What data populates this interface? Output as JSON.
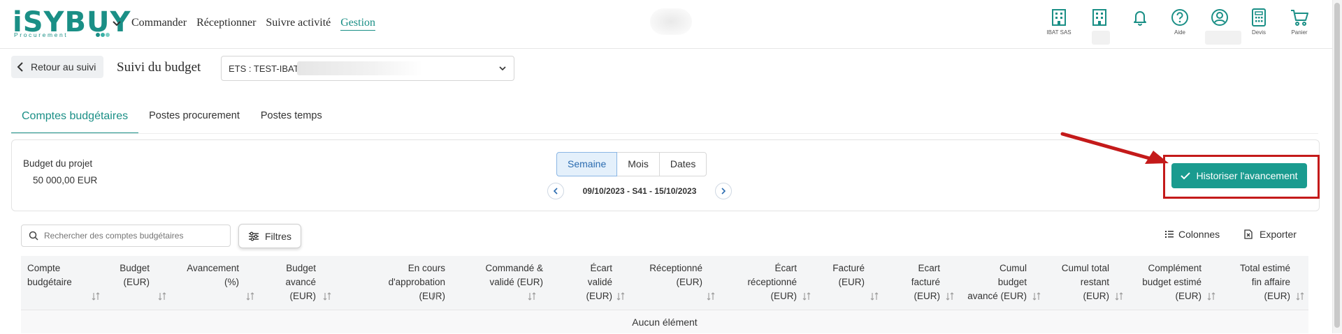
{
  "header": {
    "logo_text": "iSYBUY",
    "logo_subtext": "Procurement",
    "nav": [
      "Commander",
      "Réceptionner",
      "Suivre activité",
      "Gestion"
    ],
    "active_nav": "Gestion",
    "tools": [
      {
        "icon": "building-icon",
        "label": "IBAT SAS"
      },
      {
        "icon": "building-icon",
        "label": ""
      },
      {
        "icon": "bell-icon",
        "label": ""
      },
      {
        "icon": "help-icon",
        "label": "Aide"
      },
      {
        "icon": "user-icon",
        "label": ""
      },
      {
        "icon": "calculator-icon",
        "label": "Devis"
      },
      {
        "icon": "cart-icon",
        "label": "Panier"
      }
    ]
  },
  "subheader": {
    "back_label": "Retour au suivi",
    "title": "Suivi du budget",
    "ets_value": "ETS : TEST-IBAT"
  },
  "tabs": [
    "Comptes budgétaires",
    "Postes procurement",
    "Postes temps"
  ],
  "active_tab": "Comptes budgétaires",
  "budget": {
    "label": "Budget du projet",
    "value": "50 000,00 EUR",
    "periods": [
      "Semaine",
      "Mois",
      "Dates"
    ],
    "active_period": "Semaine",
    "range": "09/10/2023 - S41 - 15/10/2023",
    "historize_label": "Historiser l'avancement"
  },
  "toolbar": {
    "search_placeholder": "Rechercher des comptes budgétaires",
    "filters_label": "Filtres",
    "columns_label": "Colonnes",
    "export_label": "Exporter"
  },
  "table": {
    "columns": [
      [
        "Compte",
        "budgétaire"
      ],
      [
        "Budget",
        "(EUR)"
      ],
      [
        "Avancement",
        "(%)"
      ],
      [
        "Budget",
        "avancé",
        "(EUR)"
      ],
      [
        "En cours",
        "d'approbation",
        "(EUR)"
      ],
      [
        "Commandé &",
        "validé (EUR)"
      ],
      [
        "Écart",
        "validé",
        "(EUR)"
      ],
      [
        "Réceptionné",
        "(EUR)"
      ],
      [
        "Écart",
        "réceptionné",
        "(EUR)"
      ],
      [
        "Facturé",
        "(EUR)"
      ],
      [
        "Ecart",
        "facturé",
        "(EUR)"
      ],
      [
        "Cumul",
        "budget",
        "avancé (EUR)"
      ],
      [
        "Cumul total",
        "restant",
        "(EUR)"
      ],
      [
        "Complément",
        "budget estimé",
        "(EUR)"
      ],
      [
        "Total estimé",
        "fin affaire",
        "(EUR)"
      ]
    ],
    "empty_text": "Aucun élément"
  },
  "colors": {
    "brand": "#1a8f86",
    "button": "#1a9b8f",
    "highlight": "#c41a1a",
    "active_segment": "#e4f0fb"
  }
}
